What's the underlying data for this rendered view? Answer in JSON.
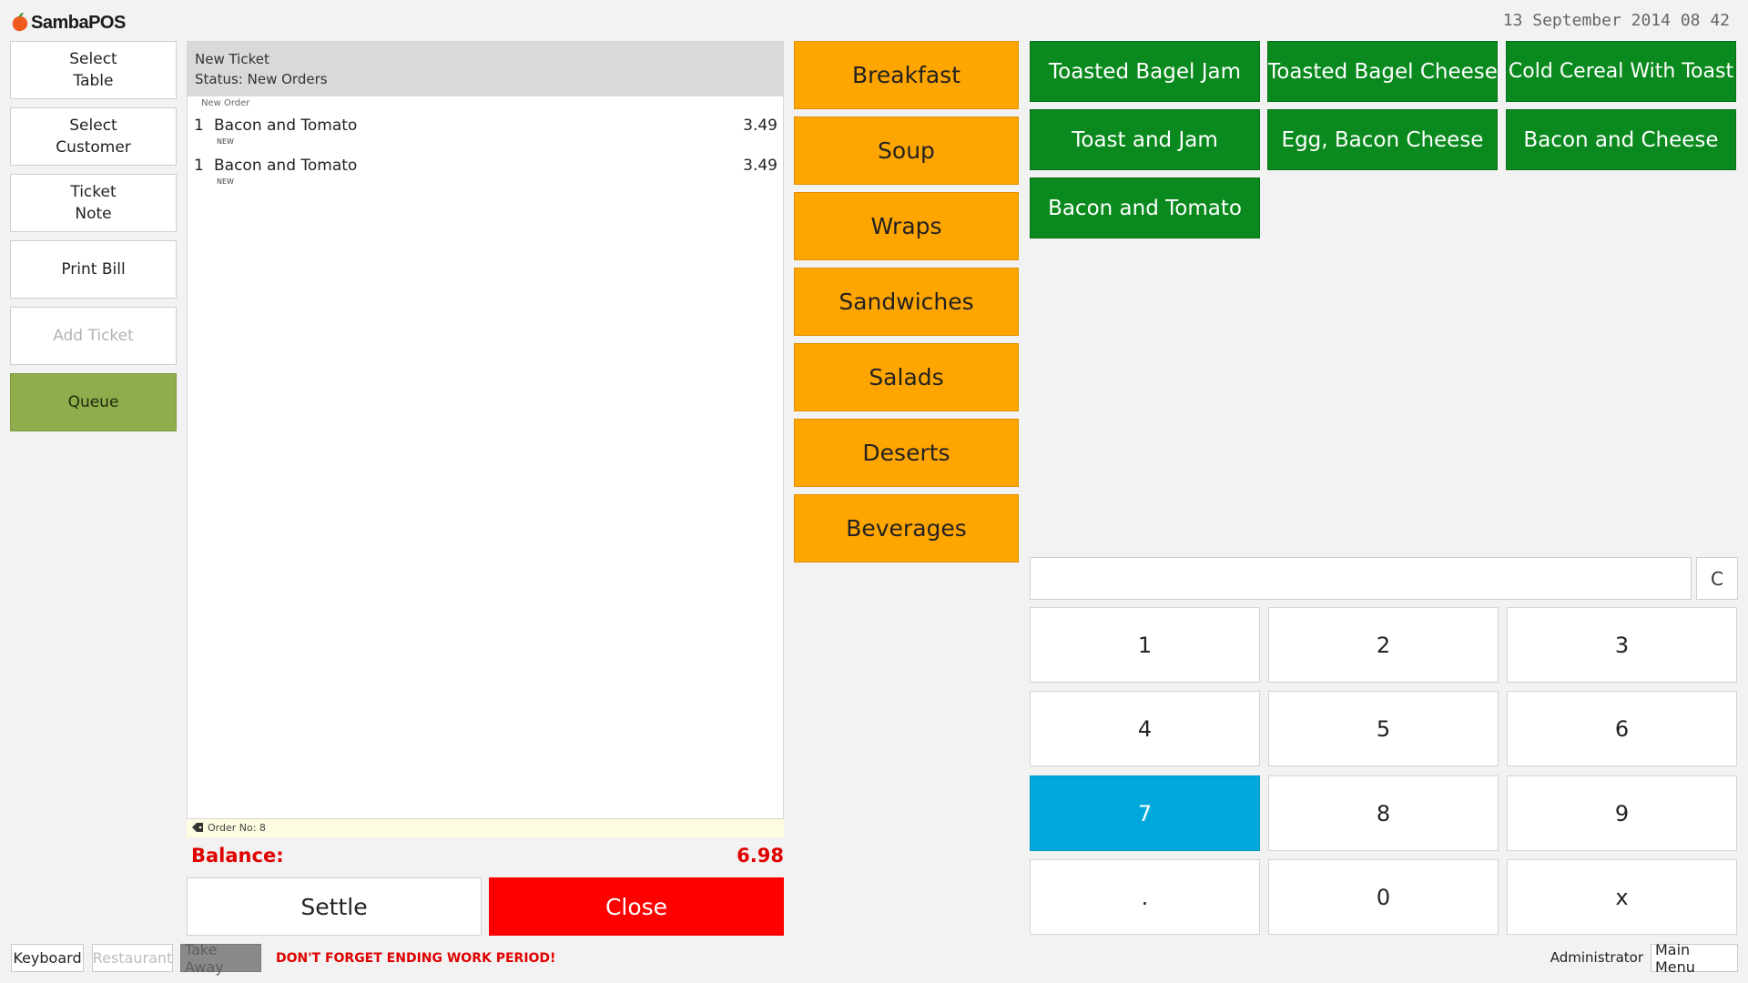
{
  "header": {
    "app_name": "SambaPOS",
    "datetime": "13 September 2014 08 42"
  },
  "commands": [
    {
      "label": "Select\nTable",
      "enabled": true
    },
    {
      "label": "Select\nCustomer",
      "enabled": true
    },
    {
      "label": "Ticket\nNote",
      "enabled": true
    },
    {
      "label": "Print Bill",
      "enabled": true
    },
    {
      "label": "Add Ticket",
      "enabled": false
    },
    {
      "label": "Queue",
      "enabled": true
    }
  ],
  "ticket": {
    "title": "New Ticket",
    "status": "Status: New Orders",
    "group_label": "New Order",
    "orders": [
      {
        "qty": "1",
        "name": "Bacon and Tomato",
        "tag": "NEW",
        "price": "3.49"
      },
      {
        "qty": "1",
        "name": "Bacon and Tomato",
        "tag": "NEW",
        "price": "3.49"
      }
    ],
    "order_no": "Order No: 8",
    "balance_label": "Balance:",
    "balance_value": "6.98",
    "settle_label": "Settle",
    "close_label": "Close"
  },
  "categories": [
    "Breakfast",
    "Soup",
    "Wraps",
    "Sandwiches",
    "Salads",
    "Deserts",
    "Beverages"
  ],
  "menu_items": [
    "Toasted Bagel Jam",
    "Toasted Bagel Cheese",
    "Cold Cereal With Toast",
    "Toast and Jam",
    "Egg, Bacon Cheese",
    "Bacon and Cheese",
    "Bacon and Tomato"
  ],
  "numpad": {
    "input_value": "",
    "clear_label": "C",
    "keys": [
      "1",
      "2",
      "3",
      "4",
      "5",
      "6",
      "7",
      "8",
      "9",
      ".",
      "0",
      "x"
    ],
    "active_key": "7"
  },
  "footer": {
    "keyboard": "Keyboard",
    "restaurant": "Restaurant",
    "take_away": "Take Away",
    "warning": "DON'T FORGET ENDING WORK PERIOD!",
    "user": "Administrator",
    "main_menu": "Main Menu"
  },
  "colors": {
    "category": "#ffa500",
    "menu_item": "#0a8a1e",
    "queue": "#8fad4c",
    "close": "#ff0000",
    "active_key": "#00a8dc",
    "balance": "#e00000"
  }
}
